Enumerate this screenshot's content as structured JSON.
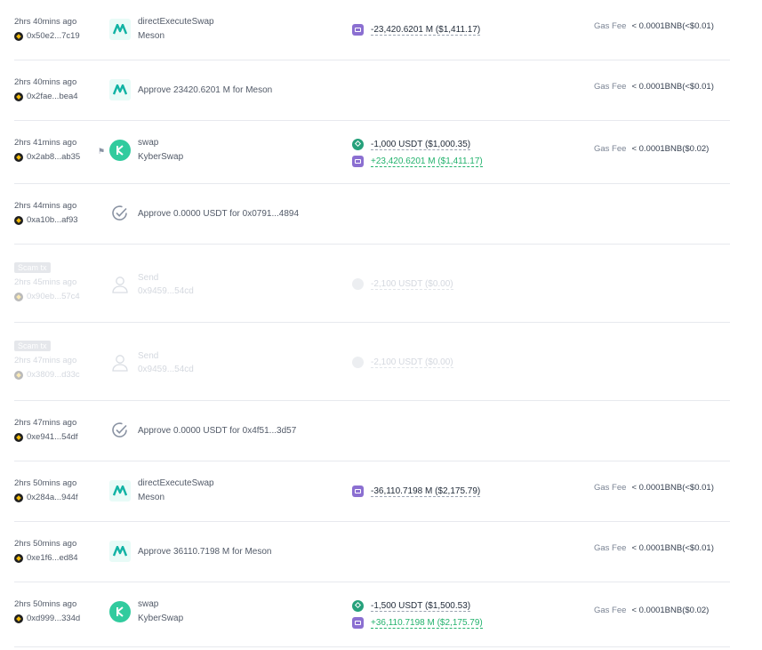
{
  "gas_label": "Gas Fee",
  "rows": [
    {
      "time": "2hrs 40mins ago",
      "address": "0x50e2...7c19",
      "icon": "meson-logo",
      "title": "directExecuteSwap",
      "subtitle": "Meson",
      "amounts": [
        {
          "token_icon": "m-token-icon",
          "text": "-23,420.6201 M ($1,411.17)",
          "sign": "negative"
        }
      ],
      "gas": "< 0.0001BNB(<$0.01)"
    },
    {
      "time": "2hrs 40mins ago",
      "address": "0x2fae...bea4",
      "icon": "meson-logo",
      "title": "Approve 23420.6201 M for Meson",
      "gas": "< 0.0001BNB(<$0.01)"
    },
    {
      "time": "2hrs 41mins ago",
      "address": "0x2ab8...ab35",
      "flag": "⚑",
      "icon": "kyberswap-logo",
      "title": "swap",
      "subtitle": "KyberSwap",
      "amounts": [
        {
          "token_icon": "usdt-token-icon",
          "text": "-1,000 USDT ($1,000.35)",
          "sign": "negative"
        },
        {
          "token_icon": "m-token-icon",
          "text": "+23,420.6201 M ($1,411.17)",
          "sign": "positive"
        }
      ],
      "gas": "< 0.0001BNB($0.02)"
    },
    {
      "time": "2hrs 44mins ago",
      "address": "0xa10b...af93",
      "icon": "approve-check-icon",
      "title": "Approve 0.0000 USDT for 0x0791...4894"
    },
    {
      "scam": "Scam tx",
      "time": "2hrs 45mins ago",
      "address": "0x90eb...57c4",
      "icon": "user-icon",
      "title": "Send",
      "subtitle": "0x9459...54cd",
      "amounts": [
        {
          "token_icon": "faded-token-icon",
          "text": "-2,100 USDT ($0.00)",
          "sign": "negative"
        }
      ]
    },
    {
      "scam": "Scam tx",
      "time": "2hrs 47mins ago",
      "address": "0x3809...d33c",
      "icon": "user-icon",
      "title": "Send",
      "subtitle": "0x9459...54cd",
      "amounts": [
        {
          "token_icon": "faded-token-icon",
          "text": "-2,100 USDT ($0.00)",
          "sign": "negative"
        }
      ]
    },
    {
      "time": "2hrs 47mins ago",
      "address": "0xe941...54df",
      "icon": "approve-check-icon",
      "title": "Approve 0.0000 USDT for 0x4f51...3d57"
    },
    {
      "time": "2hrs 50mins ago",
      "address": "0x284a...944f",
      "icon": "meson-logo",
      "title": "directExecuteSwap",
      "subtitle": "Meson",
      "amounts": [
        {
          "token_icon": "m-token-icon",
          "text": "-36,110.7198 M ($2,175.79)",
          "sign": "negative"
        }
      ],
      "gas": "< 0.0001BNB(<$0.01)"
    },
    {
      "time": "2hrs 50mins ago",
      "address": "0xe1f6...ed84",
      "icon": "meson-logo",
      "title": "Approve 36110.7198 M for Meson",
      "gas": "< 0.0001BNB(<$0.01)"
    },
    {
      "time": "2hrs 50mins ago",
      "address": "0xd999...334d",
      "icon": "kyberswap-logo",
      "title": "swap",
      "subtitle": "KyberSwap",
      "amounts": [
        {
          "token_icon": "usdt-token-icon",
          "text": "-1,500 USDT ($1,500.53)",
          "sign": "negative"
        },
        {
          "token_icon": "m-token-icon",
          "text": "+36,110.7198 M ($2,175.79)",
          "sign": "positive"
        }
      ],
      "gas": "< 0.0001BNB($0.02)"
    }
  ]
}
